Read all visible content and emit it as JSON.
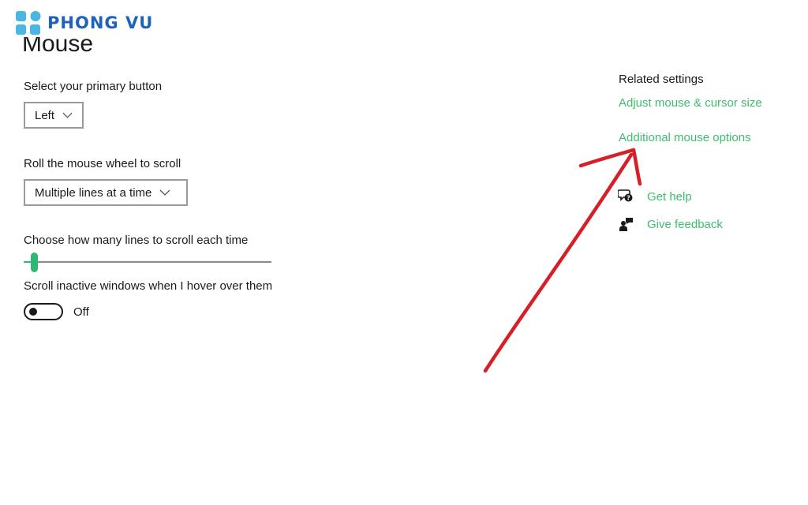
{
  "brand": {
    "name": "PHONG VU",
    "color": "#1e63b8",
    "dot_color": "#49b6e3"
  },
  "page": {
    "title": "Mouse"
  },
  "settings": {
    "primary_button": {
      "label": "Select your primary button",
      "value": "Left"
    },
    "wheel_scroll": {
      "label": "Roll the mouse wheel to scroll",
      "value": "Multiple lines at a time"
    },
    "lines_to_scroll": {
      "label": "Choose how many lines to scroll each time",
      "slider_level": 0.03
    },
    "scroll_inactive": {
      "label": "Scroll inactive windows when I hover over them",
      "state": "Off"
    }
  },
  "related": {
    "title": "Related settings",
    "links": [
      "Adjust mouse & cursor size",
      "Additional mouse options"
    ]
  },
  "support": {
    "get_help": "Get help",
    "give_feedback": "Give feedback"
  },
  "icons": {
    "chevron": "chevron-down-icon",
    "help": "help-icon",
    "feedback": "feedback-icon"
  },
  "colors": {
    "link": "#3dbd6e",
    "accent": "#2eb872",
    "annotation_arrow": "#d62027"
  }
}
